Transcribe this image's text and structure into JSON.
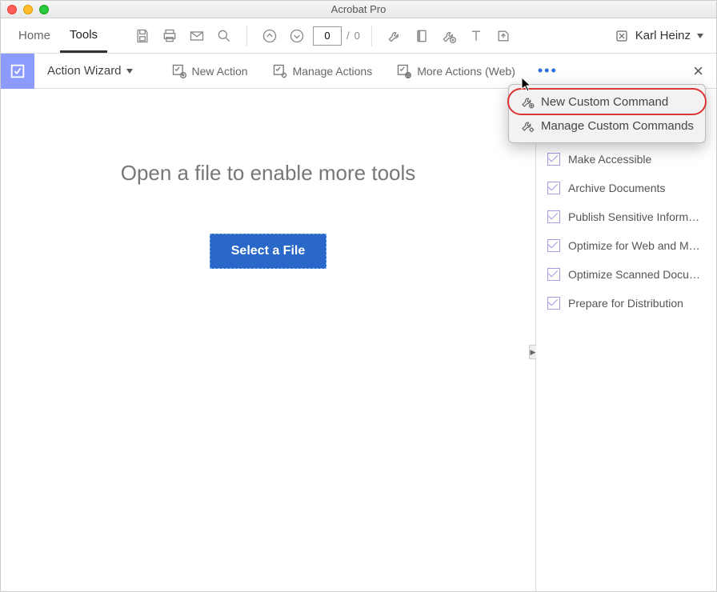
{
  "window": {
    "title": "Acrobat Pro"
  },
  "tabs": {
    "home": "Home",
    "tools": "Tools"
  },
  "toolbar": {
    "page_current": "0",
    "page_total": "0",
    "user_name": "Karl Heinz"
  },
  "subtoolbar": {
    "wizard_label": "Action Wizard",
    "new_action": "New Action",
    "manage_actions": "Manage Actions",
    "more_actions_web": "More Actions (Web)"
  },
  "main": {
    "message": "Open a file to enable more tools",
    "select_button": "Select a File"
  },
  "popup": {
    "new_custom_command": "New Custom Command",
    "manage_custom_commands": "Manage Custom Commands"
  },
  "actions_list": [
    "Make Accessible",
    "Archive Documents",
    "Publish Sensitive Inform…",
    "Optimize for Web and M…",
    "Optimize Scanned Docu…",
    "Prepare for Distribution"
  ]
}
